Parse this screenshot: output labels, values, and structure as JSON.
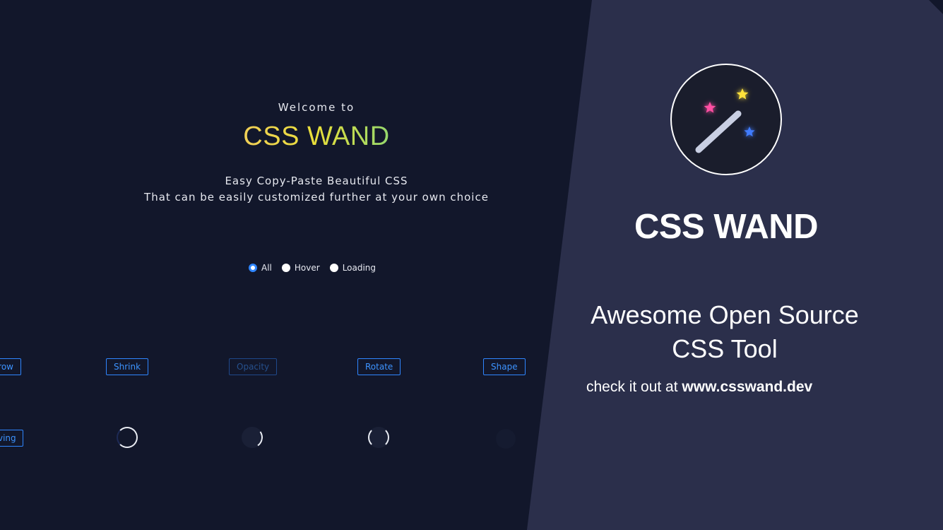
{
  "hero": {
    "welcome": "Welcome to",
    "brand": "CSS WAND",
    "tagline_1": "Easy Copy-Paste Beautiful CSS",
    "tagline_2": "That can be easily customized further at your own choice"
  },
  "filters": [
    {
      "label": "All",
      "selected": true
    },
    {
      "label": "Hover",
      "selected": false
    },
    {
      "label": "Loading",
      "selected": false
    }
  ],
  "demo_buttons": [
    "row",
    "Shrink",
    "Opacity",
    "Rotate",
    "Shape"
  ],
  "demo_buttons_row2": [
    "ving"
  ],
  "promo": {
    "title": "CSS WAND",
    "subtitle_1": "Awesome Open Source",
    "subtitle_2": "CSS Tool",
    "link_prefix": "check it out at ",
    "link_url": "www.csswand.dev"
  },
  "colors": {
    "page_bg": "#12172b",
    "panel_bg": "#2b2f4b",
    "accent": "#2f86ff",
    "star_pink": "#ff4fa3",
    "star_yellow": "#ffe23a",
    "star_blue": "#3f7bff"
  },
  "icons": [
    "magic-wand-icon",
    "star-icon"
  ]
}
